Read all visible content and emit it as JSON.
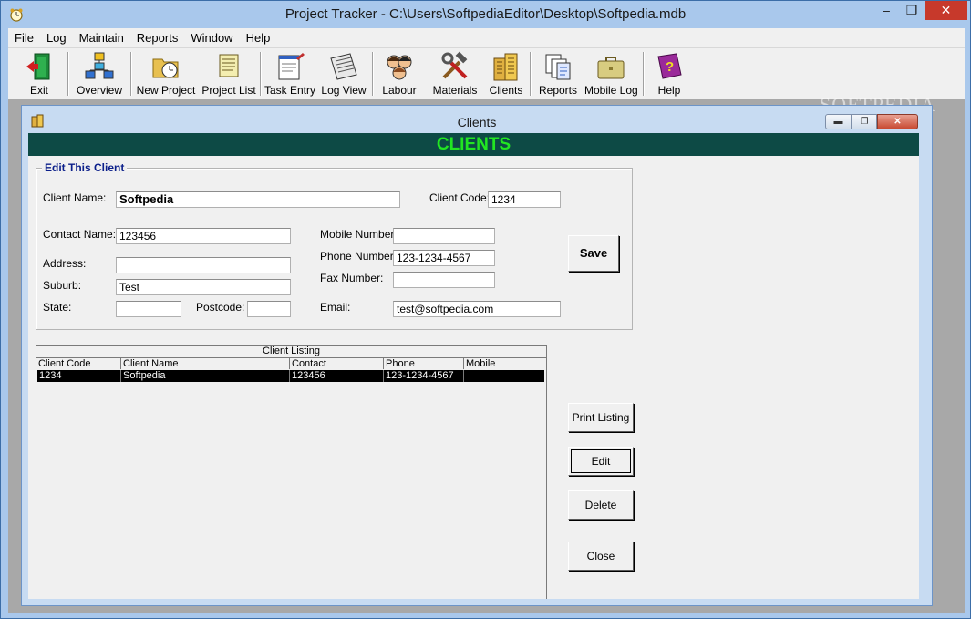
{
  "window": {
    "title": "Project Tracker - C:\\Users\\SoftpediaEditor\\Desktop\\Softpedia.mdb"
  },
  "menu": [
    "File",
    "Log",
    "Maintain",
    "Reports",
    "Window",
    "Help"
  ],
  "toolbar": [
    {
      "label": "Exit",
      "icon": "exit-door-icon"
    },
    {
      "label": "Overview",
      "icon": "hierarchy-icon"
    },
    {
      "label": "New Project",
      "icon": "folder-clock-icon"
    },
    {
      "label": "Project List",
      "icon": "scroll-icon"
    },
    {
      "label": "Task Entry",
      "icon": "notepad-pen-icon"
    },
    {
      "label": "Log View",
      "icon": "log-pages-icon"
    },
    {
      "label": "Labour",
      "icon": "people-icon"
    },
    {
      "label": "Materials",
      "icon": "tools-icon"
    },
    {
      "label": "Clients",
      "icon": "buildings-icon"
    },
    {
      "label": "Reports",
      "icon": "documents-icon"
    },
    {
      "label": "Mobile Log",
      "icon": "briefcase-icon"
    },
    {
      "label": "Help",
      "icon": "help-book-icon"
    }
  ],
  "watermark": "SOFTPEDIA",
  "child": {
    "title": "Clients",
    "banner": "CLIENTS",
    "group_title": "Edit This Client",
    "labels": {
      "client_name": "Client Name:",
      "client_code": "Client Code:",
      "contact_name": "Contact Name:",
      "address": "Address:",
      "suburb": "Suburb:",
      "state": "State:",
      "postcode": "Postcode:",
      "mobile": "Mobile Number:",
      "phone": "Phone Number:",
      "fax": "Fax Number:",
      "email": "Email:"
    },
    "values": {
      "client_name": "Softpedia",
      "client_code": "1234",
      "contact_name": "123456",
      "address": "",
      "suburb": "Test",
      "state": "",
      "postcode": "",
      "mobile": "",
      "phone": "123-1234-4567",
      "fax": "",
      "email": "test@softpedia.com"
    },
    "buttons": {
      "save": "Save",
      "print_listing": "Print Listing",
      "edit": "Edit",
      "delete": "Delete",
      "close": "Close"
    },
    "listing": {
      "caption": "Client Listing",
      "columns": [
        "Client Code",
        "Client Name",
        "Contact",
        "Phone",
        "Mobile"
      ],
      "rows": [
        [
          "1234",
          "Softpedia",
          "123456",
          "123-1234-4567",
          ""
        ]
      ]
    }
  },
  "colors": {
    "banner_bg": "#0d4a45",
    "banner_text": "#22e622",
    "group_title": "#0b1f8a",
    "selected_row": "#000000"
  }
}
